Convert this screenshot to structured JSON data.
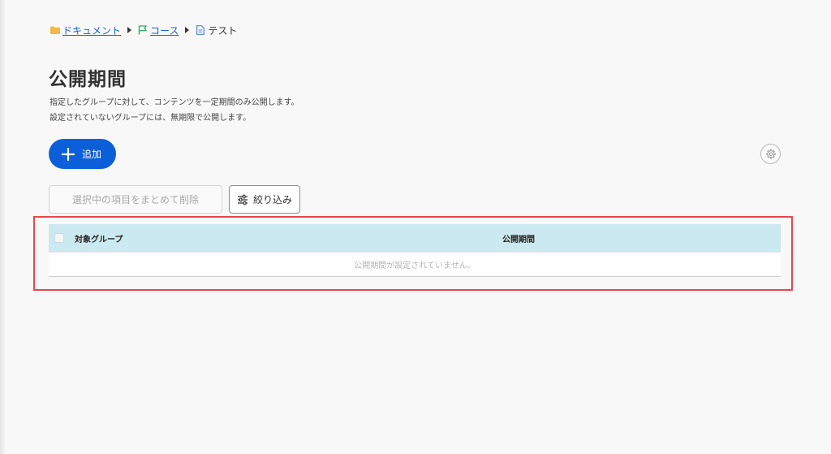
{
  "breadcrumb": [
    {
      "label": "ドキュメント",
      "icon": "folder-icon",
      "link": true
    },
    {
      "label": "コース",
      "icon": "flag-icon",
      "link": true
    },
    {
      "label": "テスト",
      "icon": "document-icon",
      "link": false
    }
  ],
  "page": {
    "title": "公開期間",
    "description_line1": "指定したグループに対して、コンテンツを一定期間のみ公開します。",
    "description_line2": "設定されていないグループには、無期限で公開します。"
  },
  "toolbar": {
    "add_label": "追加",
    "bulk_delete_label": "選択中の項目をまとめて削除",
    "filter_label": "絞り込み"
  },
  "table": {
    "columns": [
      "対象グループ",
      "公開期間"
    ],
    "empty_message": "公開期間が設定されていません。"
  },
  "colors": {
    "primary": "#0b5fd8",
    "link": "#1a62d4",
    "table_header": "#cbe9f1",
    "highlight": "#e5484d",
    "folder": "#f2b84b",
    "flag": "#3aa46a",
    "document": "#4a7fd8"
  }
}
